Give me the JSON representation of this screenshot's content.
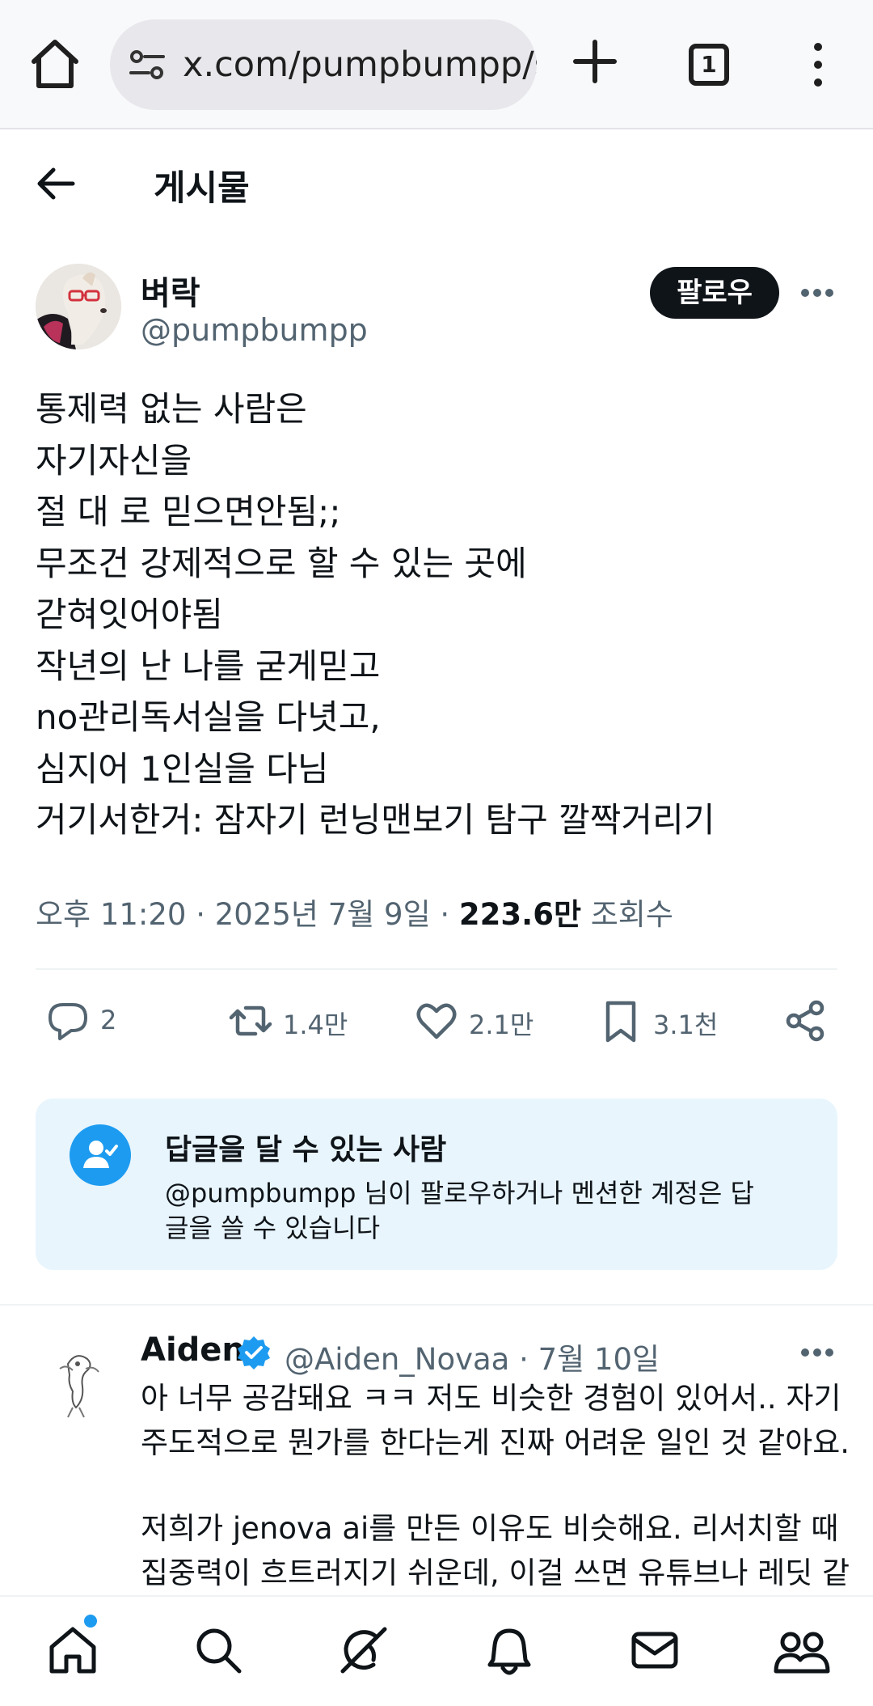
{
  "browser": {
    "url": "x.com/pumpbumpp/s",
    "tab_count": "1",
    "icons": [
      "home-icon",
      "site-settings-icon",
      "new-tab-icon",
      "tab-switcher-icon",
      "browser-menu-icon"
    ]
  },
  "header": {
    "title": "게시물"
  },
  "post": {
    "author_name": "벼락",
    "author_handle": "@pumpbumpp",
    "follow_label": "팔로우",
    "lines": [
      "통제력 없는 사람은",
      "자기자신을",
      "절 대 로 믿으면안됨;;",
      "무조건 강제적으로 할 수 있는 곳에",
      "갇혀잇어야됨",
      "작년의 난 나를 굳게믿고",
      "no관리독서실을 다녓고,",
      "심지어 1인실을 다님",
      "거기서한거: 잠자기 런닝맨보기 탐구 깔짝거리기"
    ],
    "time": "오후 11:20 · 2025년 7월 9일 · ",
    "views": "223.6만",
    "views_label": " 조회수"
  },
  "actions": {
    "replies": "2",
    "reposts": "1.4만",
    "likes": "2.1만",
    "bookmarks": "3.1천"
  },
  "reply_restriction": {
    "title": "답글을 달 수 있는 사람",
    "body_line1": "@pumpbumpp 님이 팔로우하거나 멘션한 계정은 답",
    "body_line2": "글을 쓸 수 있습니다"
  },
  "reply": {
    "name": "Aiden",
    "handle_date": "@Aiden_Novaa · 7월 10일",
    "lines": [
      "아 너무 공감돼요 ㅋㅋ 저도 비슷한 경험이 있어서.. 자기",
      "주도적으로 뭔가를 한다는게 진짜 어려운 일인 것 같아요."
    ],
    "lines2": [
      "저희가 jenova ai를 만든 이유도 비슷해요. 리서치할 때",
      "집중력이 흐트러지기 쉬운데, 이걸 쓰면 유튜브나 레딧 같"
    ]
  },
  "colors": {
    "accent": "#1d9bf0",
    "text_primary": "#0f1419",
    "text_secondary": "#536471",
    "card_bg": "#e8f5fd",
    "follow_bg": "#0f1419"
  },
  "bottom_nav": {
    "icons": [
      "home-icon",
      "search-icon",
      "grok-icon",
      "notifications-icon",
      "messages-icon",
      "communities-icon"
    ]
  }
}
